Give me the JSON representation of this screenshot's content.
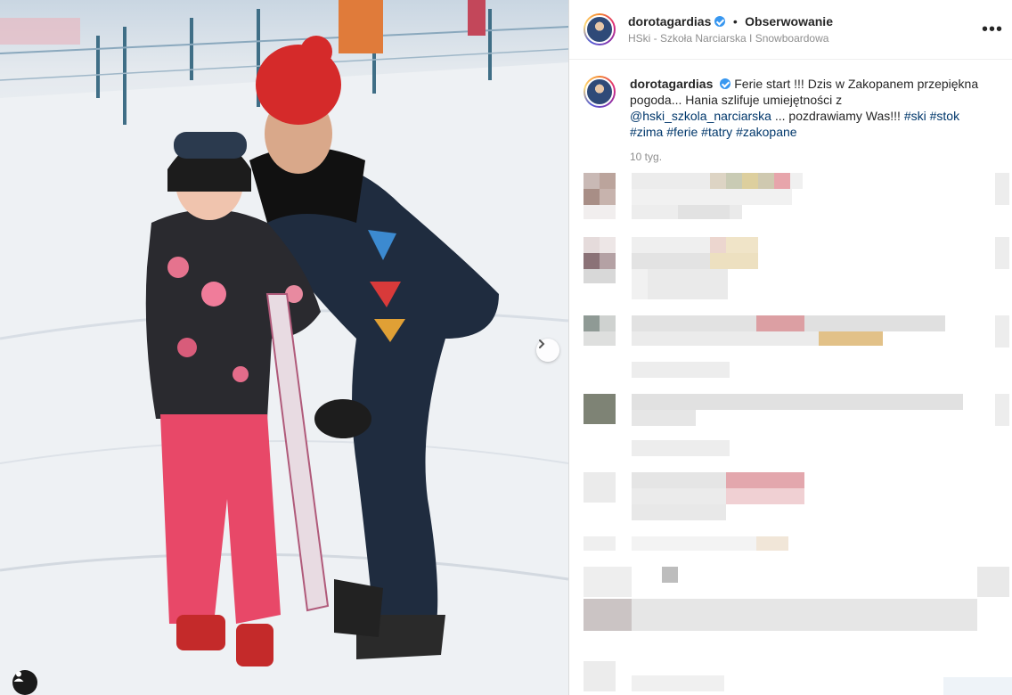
{
  "header": {
    "username": "dorotagardias",
    "follow_label": "Obserwowanie",
    "separator": "•",
    "location": "HSki - Szkoła Narciarska I Snowboardowa",
    "more_label": "•••"
  },
  "caption": {
    "username": "dorotagardias",
    "text_before": "Ferie start !!! Dzis w Zakopanem przepiękna pogoda... Hania szlifuje umiejętności z",
    "mention": "@hski_szkola_narciarska",
    "text_after": "... pozdrawiamy Was!!!",
    "hashtags": [
      "#ski",
      "#stok",
      "#zima",
      "#ferie",
      "#tatry",
      "#zakopane"
    ],
    "time_ago": "10 tyg."
  },
  "photo": {
    "next_icon": "chevron-right-icon",
    "tag_icon": "user-tag-icon"
  },
  "colors": {
    "verified": "#3897f0",
    "link": "#00376b",
    "muted": "#8e8e8e"
  }
}
